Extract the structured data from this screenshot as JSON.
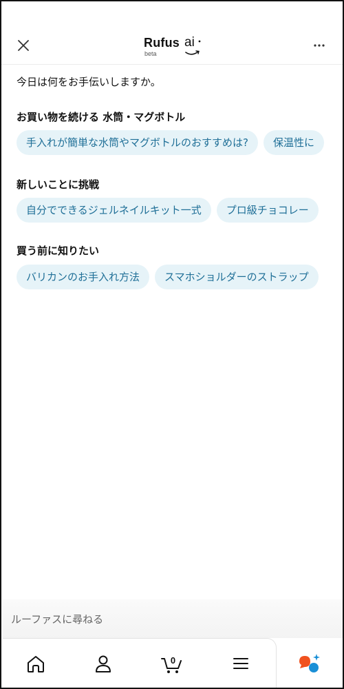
{
  "header": {
    "logo_text": "Rufus",
    "logo_ai": "ai",
    "logo_beta": "beta"
  },
  "greeting": "今日は何をお手伝いしますか。",
  "sections": [
    {
      "title": "お買い物を続ける 水筒・マグボトル",
      "chips": [
        "手入れが簡単な水筒やマグボトルのおすすめは?",
        "保温性に"
      ]
    },
    {
      "title": "新しいことに挑戦",
      "chips": [
        "自分でできるジェルネイルキット一式",
        "プロ級チョコレー"
      ]
    },
    {
      "title": "買う前に知りたい",
      "chips": [
        "バリカンのお手入れ方法",
        "スマホショルダーのストラップ"
      ]
    }
  ],
  "input": {
    "placeholder": "ルーファスに尋ねる"
  },
  "nav": {
    "cart_count": "0"
  },
  "colors": {
    "chip_bg": "#e6f3f8",
    "chip_text": "#1f6f97",
    "rufus_orange": "#f0521f",
    "rufus_blue": "#1a8fd6"
  }
}
